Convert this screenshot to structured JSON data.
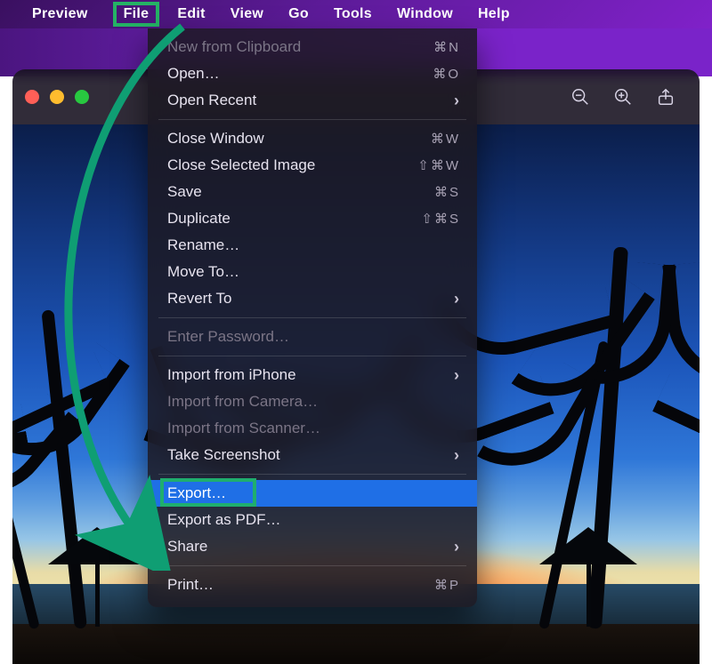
{
  "menubar": {
    "app": "Preview",
    "items": [
      "File",
      "Edit",
      "View",
      "Go",
      "Tools",
      "Window",
      "Help"
    ],
    "highlighted": "File"
  },
  "toolbar": {
    "icons": [
      "zoom-out-icon",
      "zoom-in-icon",
      "share-icon"
    ]
  },
  "file_menu": {
    "groups": [
      [
        {
          "label": "New from Clipboard",
          "shortcut": "⌘ N",
          "enabled": false
        },
        {
          "label": "Open…",
          "shortcut": "⌘ O",
          "enabled": true
        },
        {
          "label": "Open Recent",
          "submenu": true,
          "enabled": true
        }
      ],
      [
        {
          "label": "Close Window",
          "shortcut": "⌘ W",
          "enabled": true
        },
        {
          "label": "Close Selected Image",
          "shortcut": "⇧ ⌘ W",
          "enabled": true
        },
        {
          "label": "Save",
          "shortcut": "⌘ S",
          "enabled": true
        },
        {
          "label": "Duplicate",
          "shortcut": "⇧ ⌘ S",
          "enabled": true
        },
        {
          "label": "Rename…",
          "enabled": true
        },
        {
          "label": "Move To…",
          "enabled": true
        },
        {
          "label": "Revert To",
          "submenu": true,
          "enabled": true
        }
      ],
      [
        {
          "label": "Enter Password…",
          "enabled": false
        }
      ],
      [
        {
          "label": "Import from iPhone",
          "submenu": true,
          "enabled": true
        },
        {
          "label": "Import from Camera…",
          "enabled": false
        },
        {
          "label": "Import from Scanner…",
          "enabled": false
        },
        {
          "label": "Take Screenshot",
          "submenu": true,
          "enabled": true
        }
      ],
      [
        {
          "label": "Export…",
          "enabled": true,
          "selected": true,
          "annotation_highlight": true
        },
        {
          "label": "Export as PDF…",
          "enabled": true
        },
        {
          "label": "Share",
          "submenu": true,
          "enabled": true
        }
      ],
      [
        {
          "label": "Print…",
          "shortcut": "⌘ P",
          "enabled": true
        }
      ]
    ]
  },
  "annotation": {
    "arrow_color": "#0f9e73"
  }
}
